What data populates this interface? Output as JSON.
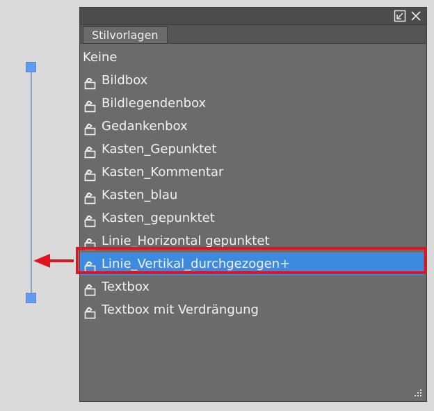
{
  "panel": {
    "tab_label": "Stilvorlagen",
    "collapse_icon": "collapse-icon",
    "close_icon": "close-icon"
  },
  "styles": [
    {
      "label": "Keine",
      "icon": false
    },
    {
      "label": "Bildbox",
      "icon": true
    },
    {
      "label": "Bildlegendenbox",
      "icon": true
    },
    {
      "label": "Gedankenbox",
      "icon": true
    },
    {
      "label": "Kasten_Gepunktet",
      "icon": true
    },
    {
      "label": "Kasten_Kommentar",
      "icon": true
    },
    {
      "label": "Kasten_blau",
      "icon": true
    },
    {
      "label": "Kasten_gepunktet",
      "icon": true
    },
    {
      "label": "Linie_Horizontal gepunktet",
      "icon": true
    },
    {
      "label": "Linie_Vertikal_durchgezogen+",
      "icon": true,
      "selected": true
    },
    {
      "label": "Textbox",
      "icon": true
    },
    {
      "label": "Textbox mit Verdrängung",
      "icon": true
    }
  ],
  "colors": {
    "selection": "#3d8be0",
    "highlight_border": "#e0141e",
    "handle": "#5f9bf5"
  }
}
